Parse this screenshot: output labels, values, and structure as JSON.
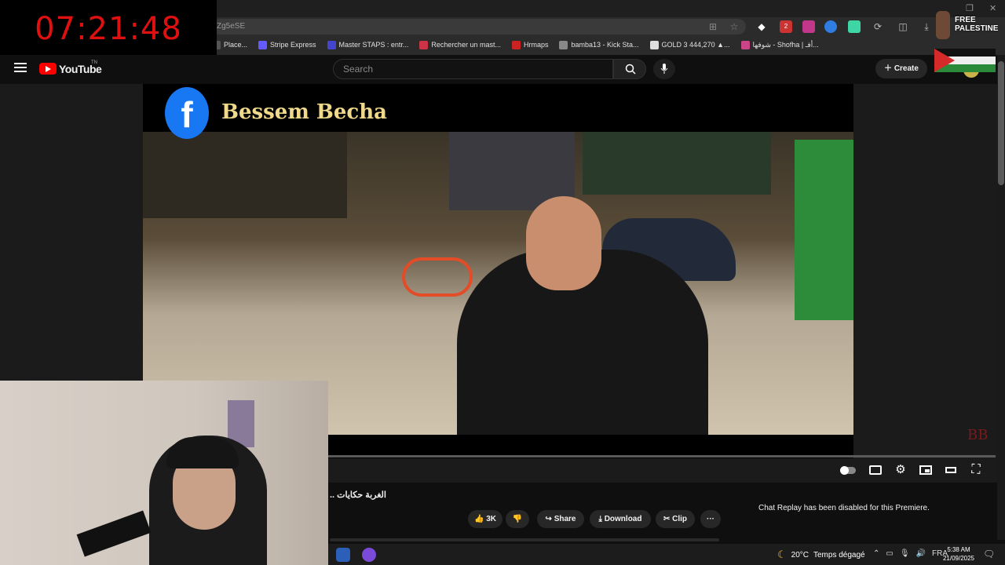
{
  "overlay": {
    "clock": "07:21:48",
    "free_palestine": "FREE PALESTINE"
  },
  "browser": {
    "address_fragment": "Zg5eSE",
    "bookmarks": [
      {
        "label": "Place...",
        "color": "#555555"
      },
      {
        "label": "Stripe Express",
        "color": "#635bff"
      },
      {
        "label": "Master STAPS : entr...",
        "color": "#4444cc"
      },
      {
        "label": "Rechercher un mast...",
        "color": "#cc3344"
      },
      {
        "label": "Hrmaps",
        "color": "#cc2222"
      },
      {
        "label": "bamba13 - Kick Sta...",
        "color": "#888888"
      },
      {
        "label": "GOLD 3 444,270 ▲...",
        "color": "#dddddd"
      },
      {
        "label": "شوفها - Shofha | أفـ...",
        "color": "#cc4488"
      }
    ],
    "ext_badge": "2"
  },
  "youtube": {
    "logo_text": "YouTube",
    "country": "TN",
    "search_placeholder": "Search",
    "create_label": "Create"
  },
  "video": {
    "channel_watermark": "Bessem Becha",
    "fb_letter": "f",
    "corner_mark": "BB",
    "title": "الغربة حكايات ..",
    "likes": "3K",
    "share_label": "Share",
    "download_label": "Download",
    "clip_label": "Clip",
    "more_label": "···",
    "chat_replay": "Chat Replay has been disabled for this Premiere."
  },
  "taskbar": {
    "temperature": "20°C",
    "weather": "Temps dégagé",
    "language": "FRA",
    "time": "5:38 AM",
    "date": "21/09/2025"
  },
  "colors": {
    "youtube_red": "#ff0000",
    "clock_red": "#e01010",
    "facebook_blue": "#1877f2"
  }
}
